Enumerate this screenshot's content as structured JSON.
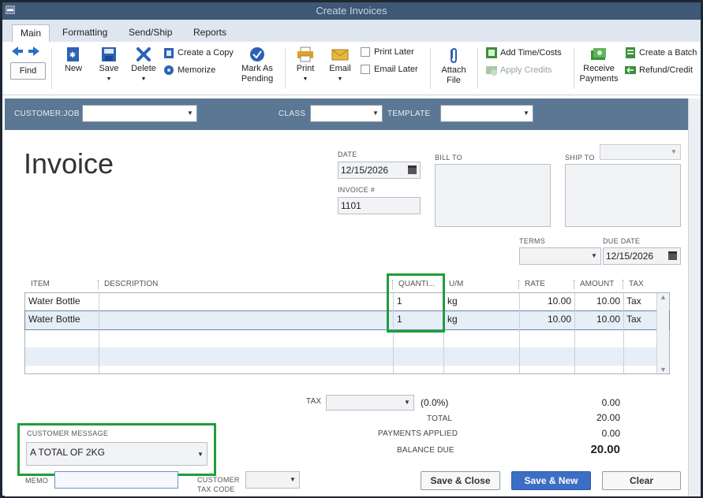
{
  "window": {
    "title": "Create Invoices"
  },
  "tabs": [
    {
      "label": "Main"
    },
    {
      "label": "Formatting"
    },
    {
      "label": "Send/Ship"
    },
    {
      "label": "Reports"
    }
  ],
  "toolbar": {
    "find": "Find",
    "new": "New",
    "save": "Save",
    "delete": "Delete",
    "create_copy": "Create a Copy",
    "memorize": "Memorize",
    "mark_as_pending_1": "Mark As",
    "mark_as_pending_2": "Pending",
    "print": "Print",
    "email": "Email",
    "print_later": "Print Later",
    "email_later": "Email Later",
    "attach_file_1": "Attach",
    "attach_file_2": "File",
    "add_time_costs": "Add Time/Costs",
    "apply_credits": "Apply Credits",
    "receive_payments_1": "Receive",
    "receive_payments_2": "Payments",
    "create_batch": "Create a Batch",
    "refund_credit": "Refund/Credit"
  },
  "header": {
    "customer_job_label": "CUSTOMER:JOB",
    "class_label": "CLASS",
    "template_label": "TEMPLATE",
    "customer_job_value": "",
    "class_value": "",
    "template_value": ""
  },
  "form": {
    "title": "Invoice",
    "date_label": "DATE",
    "date_value": "12/15/2026",
    "invoice_no_label": "INVOICE #",
    "invoice_no_value": "1101",
    "bill_to_label": "BILL TO",
    "ship_to_label": "SHIP TO",
    "terms_label": "TERMS",
    "due_date_label": "DUE DATE",
    "due_date_value": "12/15/2026"
  },
  "grid": {
    "columns": [
      "ITEM",
      "DESCRIPTION",
      "QUANTI...",
      "U/M",
      "RATE",
      "AMOUNT",
      "TAX"
    ],
    "rows": [
      {
        "item": "Water Bottle",
        "description": "",
        "quantity": "1",
        "um": "kg",
        "rate": "10.00",
        "amount": "10.00",
        "tax": "Tax"
      },
      {
        "item": "Water Bottle",
        "description": "",
        "quantity": "1",
        "um": "kg",
        "rate": "10.00",
        "amount": "10.00",
        "tax": "Tax"
      }
    ]
  },
  "totals": {
    "tax_label": "TAX",
    "tax_rate": "(0.0%)",
    "tax_amount": "0.00",
    "total_label": "TOTAL",
    "total_value": "20.00",
    "payments_label": "PAYMENTS APPLIED",
    "payments_value": "0.00",
    "balance_label": "BALANCE DUE",
    "balance_value": "20.00"
  },
  "footer": {
    "customer_message_label": "CUSTOMER MESSAGE",
    "customer_message_value": "A TOTAL OF 2KG",
    "memo_label": "MEMO",
    "customer_tax_code_label_1": "CUSTOMER",
    "customer_tax_code_label_2": "TAX CODE",
    "save_close": "Save & Close",
    "save_new": "Save & New",
    "clear": "Clear"
  },
  "colors": {
    "highlight": "#1f9e3a",
    "header_bar": "#5b7794",
    "primary_button": "#3b6fc4"
  }
}
